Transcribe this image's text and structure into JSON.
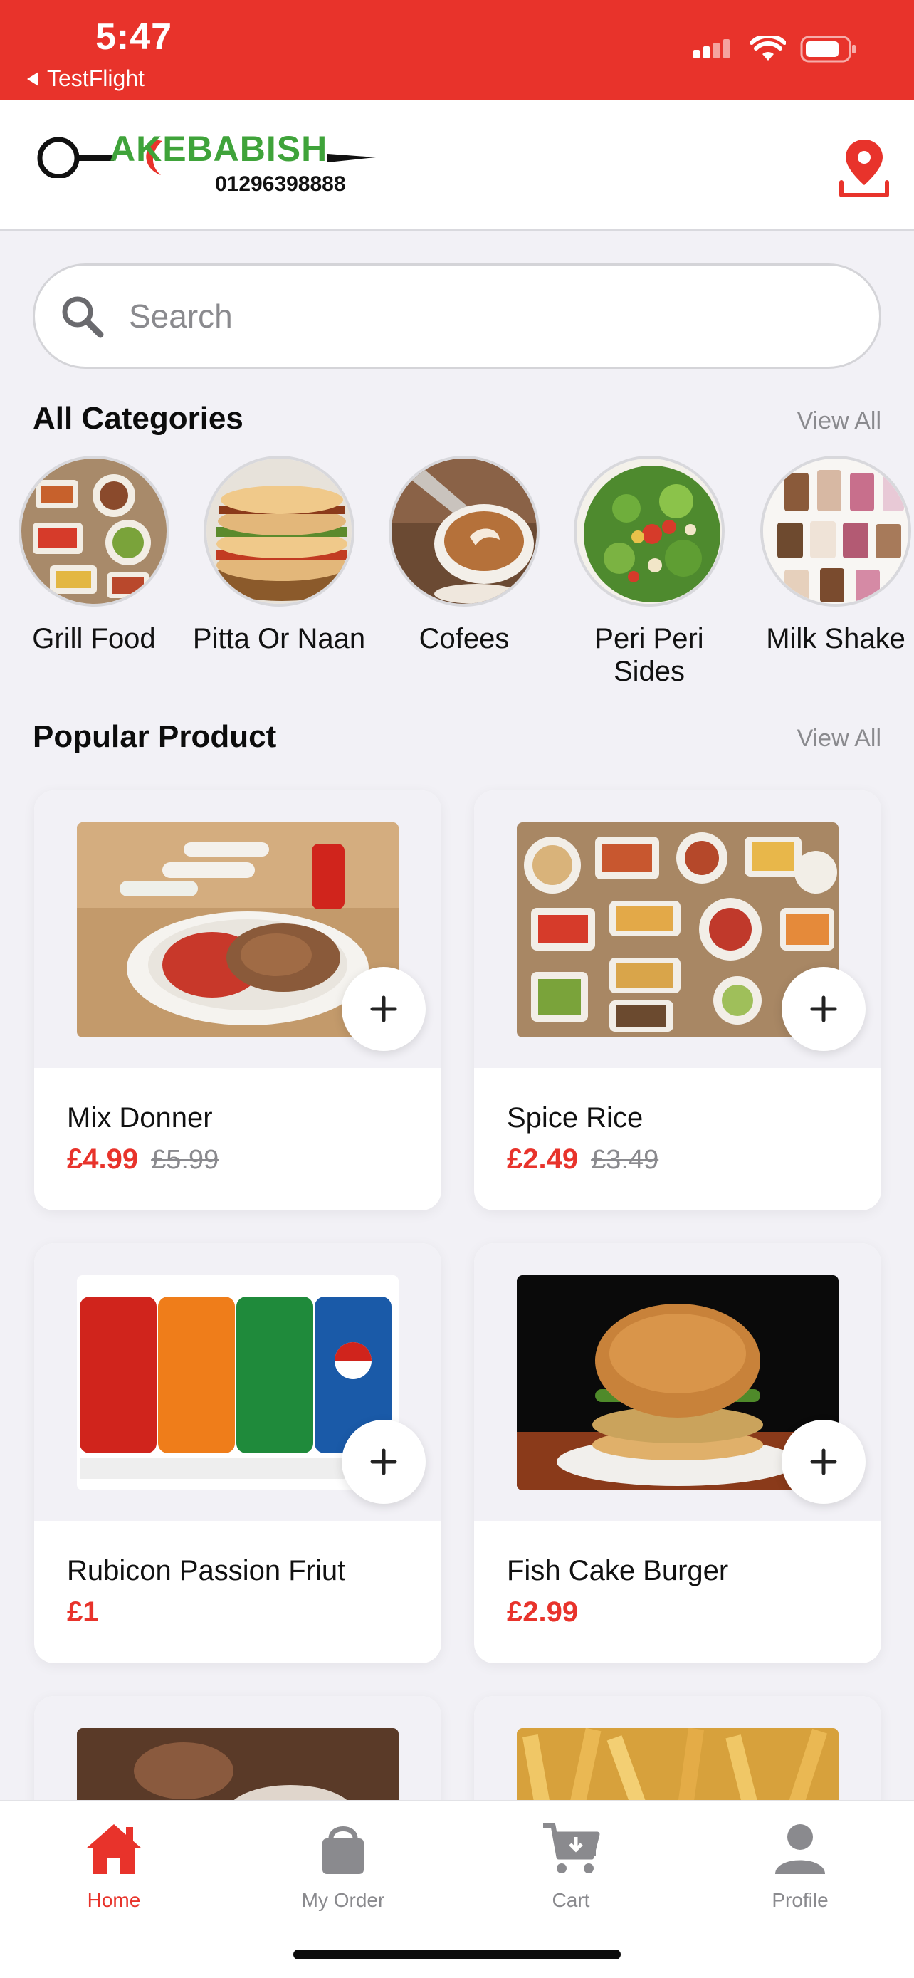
{
  "status_bar": {
    "time": "5:47",
    "back_app": "TestFlight",
    "background_color": "#e8332b"
  },
  "header": {
    "logo_text": "AKEBABISH",
    "logo_phone": "01296398888",
    "location_icon": "location-pin-icon"
  },
  "search": {
    "placeholder": "Search",
    "icon": "search-icon"
  },
  "categories_section": {
    "title": "All Categories",
    "view_all": "View All",
    "items": [
      {
        "label": "Grill Food"
      },
      {
        "label": "Pitta Or Naan"
      },
      {
        "label": "Cofees"
      },
      {
        "label": "Peri Peri Sides"
      },
      {
        "label": "Milk Shake"
      }
    ]
  },
  "popular_section": {
    "title": "Popular Product",
    "view_all": "View All",
    "products": [
      {
        "name": "Mix Donner",
        "price": "£4.99",
        "old_price": "£5.99"
      },
      {
        "name": "Spice Rice",
        "price": "£2.49",
        "old_price": "£3.49"
      },
      {
        "name": "Rubicon Passion Friut",
        "price": "£1",
        "old_price": ""
      },
      {
        "name": "Fish Cake Burger",
        "price": "£2.99",
        "old_price": ""
      }
    ]
  },
  "bottom_nav": {
    "items": [
      {
        "label": "Home",
        "icon": "home-icon",
        "active": true
      },
      {
        "label": "My Order",
        "icon": "bag-icon",
        "active": false
      },
      {
        "label": "Cart",
        "icon": "cart-icon",
        "active": false
      },
      {
        "label": "Profile",
        "icon": "profile-icon",
        "active": false
      }
    ]
  },
  "colors": {
    "accent": "#e8332b",
    "logo_green": "#3fa33a",
    "muted": "#8a8a8e",
    "background": "#f2f1f6"
  }
}
